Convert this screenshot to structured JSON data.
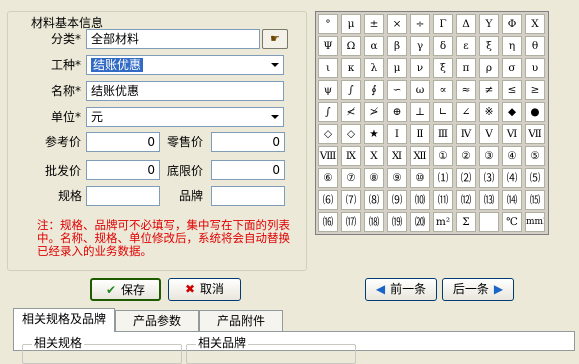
{
  "group_title": "材料基本信息",
  "form": {
    "category_label": "分类*",
    "category_value": "全部材料",
    "worktype_label": "工种*",
    "worktype_value": "结账优惠",
    "name_label": "名称*",
    "name_value": "结账优惠",
    "unit_label": "单位*",
    "unit_value": "元",
    "ref_price_label": "参考价",
    "ref_price_value": "0",
    "retail_price_label": "零售价",
    "retail_price_value": "0",
    "wholesale_price_label": "批发价",
    "wholesale_price_value": "0",
    "floor_price_label": "底限价",
    "floor_price_value": "0",
    "spec_label": "规格",
    "spec_value": "",
    "brand_label": "品牌",
    "brand_value": ""
  },
  "note": "注：规格、品牌可不必填写，集中写在下面的列表中。名称、规格、单位修改后，系统将会自动替换已经录入的业务数据。",
  "symbols": [
    [
      "°",
      "μ",
      "±",
      "×",
      "÷",
      "Γ",
      "Δ",
      "Υ",
      "Φ",
      "X"
    ],
    [
      "Ψ",
      "Ω",
      "α",
      "β",
      "γ",
      "δ",
      "ε",
      "ξ",
      "η",
      "θ"
    ],
    [
      "ι",
      "κ",
      "λ",
      "μ",
      "ν",
      "ξ",
      "π",
      "ρ",
      "σ",
      "υ"
    ],
    [
      "ψ",
      "∫",
      "∮",
      "∽",
      "ω",
      "∝",
      "≈",
      "≠",
      "≤",
      "≥"
    ],
    [
      "∫",
      "≮",
      "≯",
      "⊕",
      "⊥",
      "∟",
      "∠",
      "※",
      "◆",
      "●"
    ],
    [
      "◇",
      "◇",
      "★",
      "Ⅰ",
      "Ⅱ",
      "Ⅲ",
      "Ⅳ",
      "Ⅴ",
      "Ⅵ",
      "Ⅶ"
    ],
    [
      "Ⅷ",
      "Ⅸ",
      "Ⅹ",
      "Ⅺ",
      "Ⅻ",
      "①",
      "②",
      "③",
      "④",
      "⑤"
    ],
    [
      "⑥",
      "⑦",
      "⑧",
      "⑨",
      "⑩",
      "⑴",
      "⑵",
      "⑶",
      "⑷",
      "⑸"
    ],
    [
      "⑹",
      "⑺",
      "⑻",
      "⑼",
      "⑽",
      "⑾",
      "⑿",
      "⒀",
      "⒁",
      "⒂"
    ],
    [
      "⒃",
      "⒄",
      "⒅",
      "⒆",
      "⒇",
      "m²",
      "Σ",
      "",
      "℃",
      "mm2"
    ]
  ],
  "buttons": {
    "save": "保存",
    "cancel": "取消",
    "prev": "前一条",
    "next": "后一条"
  },
  "tabs": [
    "相关规格及品牌",
    "产品参数",
    "产品附件"
  ],
  "panel": {
    "spec_title": "相关规格",
    "brand_title": "相关品牌"
  }
}
